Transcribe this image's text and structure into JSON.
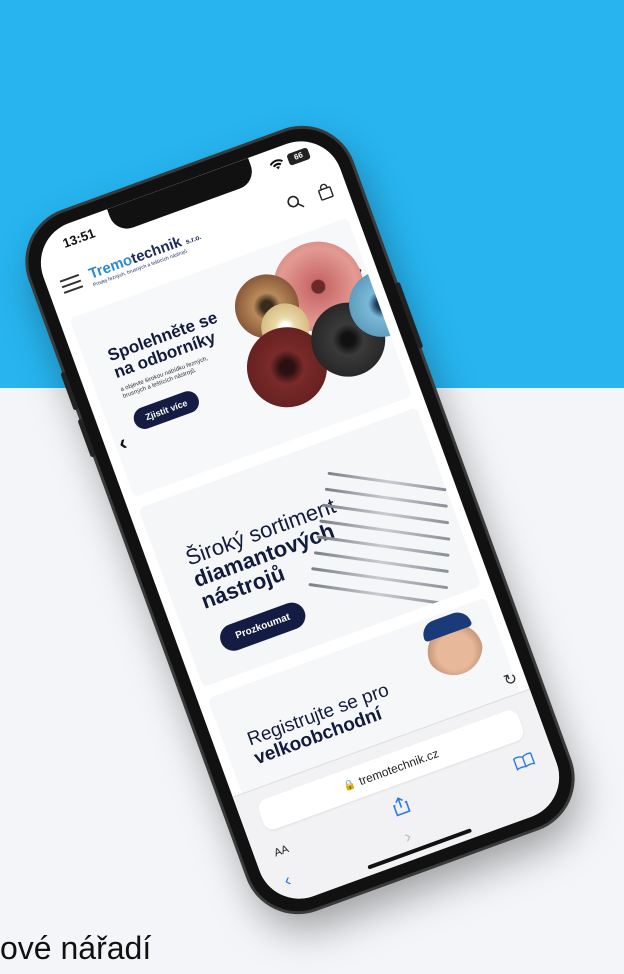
{
  "caption": "ové nářadí",
  "status": {
    "time": "13:51",
    "battery": "66"
  },
  "header": {
    "logo_part1": "Tremo",
    "logo_part2": "technik",
    "logo_suffix": "s.r.o.",
    "logo_tagline": "Prodej řezných, brusných a leštících nástrojů"
  },
  "banners": [
    {
      "title_line1": "Spolehněte se",
      "title_line2": "na odborníky",
      "subtitle": "a objevte širokou nabídku řezných, brusných a leštících nástrojů.",
      "cta": "Zjistit více"
    },
    {
      "title_line1": "Široký sortiment",
      "title_line2": "diamantových",
      "title_line3": "nástrojů",
      "cta": "Prozkoumat"
    },
    {
      "title_line1": "Registrujte se pro",
      "title_line2": "velkoobchodní"
    }
  ],
  "browser": {
    "text_size": "AA",
    "url": "tremotechnik.cz"
  },
  "colors": {
    "sky": "#27b4ef",
    "navy": "#141c44",
    "brand_blue": "#2a8ad6"
  }
}
